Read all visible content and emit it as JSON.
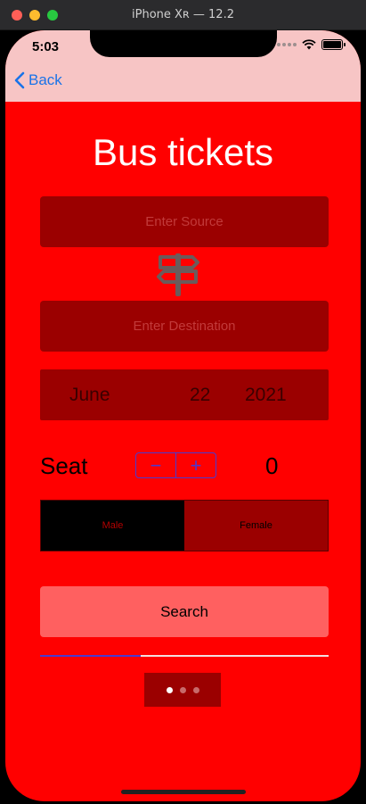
{
  "window": {
    "title": "iPhone Xʀ — 12.2"
  },
  "status_bar": {
    "time": "5:03"
  },
  "nav": {
    "back_label": "Back"
  },
  "page": {
    "title": "Bus tickets"
  },
  "source": {
    "placeholder": "Enter Source",
    "value": ""
  },
  "destination": {
    "placeholder": "Enter Destination",
    "value": ""
  },
  "date_picker": {
    "month": "June",
    "day": "22",
    "year": "2021"
  },
  "seat": {
    "label": "Seat",
    "minus_label": "−",
    "plus_label": "+",
    "count": "0"
  },
  "gender": {
    "options": [
      "Male",
      "Female"
    ],
    "selected": "Male"
  },
  "search": {
    "label": "Search"
  },
  "progress": {
    "value": 0.35
  },
  "page_control": {
    "pages": 3,
    "current": 0
  },
  "colors": {
    "background": "#ff0000",
    "nav_background": "#f7c5c5",
    "field": "#9b0000",
    "accent": "#4a3ad0",
    "search_button": "#ff6060",
    "back_link": "#1a73e8"
  }
}
